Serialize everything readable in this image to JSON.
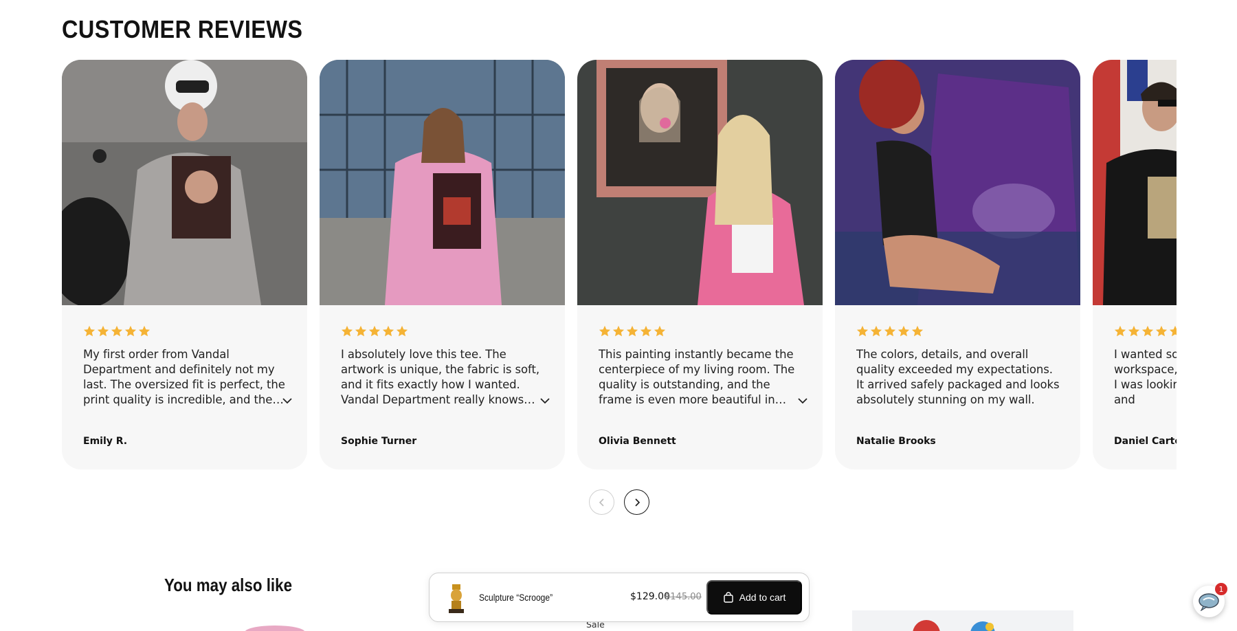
{
  "section_title": "CUSTOMER REVIEWS",
  "reviews": [
    {
      "text": "My first order from Vandal Department and definitely not my last. The oversized fit is perfect, the print quality is incredible, and the shirt feels premium.",
      "author": "Emily R.",
      "rating": 5,
      "photo_icon": "photo-woman-helmet-motorcycle"
    },
    {
      "text": "I absolutely love this tee. The artwork is unique, the fabric is soft, and it fits exactly how I wanted. Vandal Department really knows how to",
      "author": "Sophie Turner",
      "rating": 5,
      "photo_icon": "photo-woman-pink-tee"
    },
    {
      "text": "This painting instantly became the centerpiece of my living room. The quality is outstanding, and the frame is even more beautiful in person. Amazing",
      "author": "Olivia Bennett",
      "rating": 5,
      "photo_icon": "photo-woman-framed-painting"
    },
    {
      "text": "The colors, details, and overall quality exceeded my expectations. It arrived safely packaged and looks absolutely stunning on my wall.",
      "author": "Natalie Brooks",
      "rating": 5,
      "photo_icon": "photo-woman-purple-canvas"
    },
    {
      "text": "I wanted something for my workspace, and this is exactly what I was looking for. It adds personality and",
      "author": "Daniel Carter",
      "rating": 5,
      "photo_icon": "photo-man-black-tee"
    }
  ],
  "carousel": {
    "prev_icon": "chevron-left-icon",
    "next_icon": "chevron-right-icon"
  },
  "also_like_title": "You may also like",
  "sale_label": "Sale",
  "sticky_cart": {
    "product_name": "Sculpture “Scrooge”",
    "price": "$129.00",
    "compare_price": "$145.00",
    "button_label": "Add to cart",
    "button_icon": "shopping-bag-icon"
  },
  "chat": {
    "icon": "chat-bubble-icon",
    "badge_count": "1"
  },
  "colors": {
    "star": "#f5b335",
    "card_bg": "#f7f7f7",
    "button_bg": "#0d0d0d",
    "badge": "#d62b2b"
  }
}
